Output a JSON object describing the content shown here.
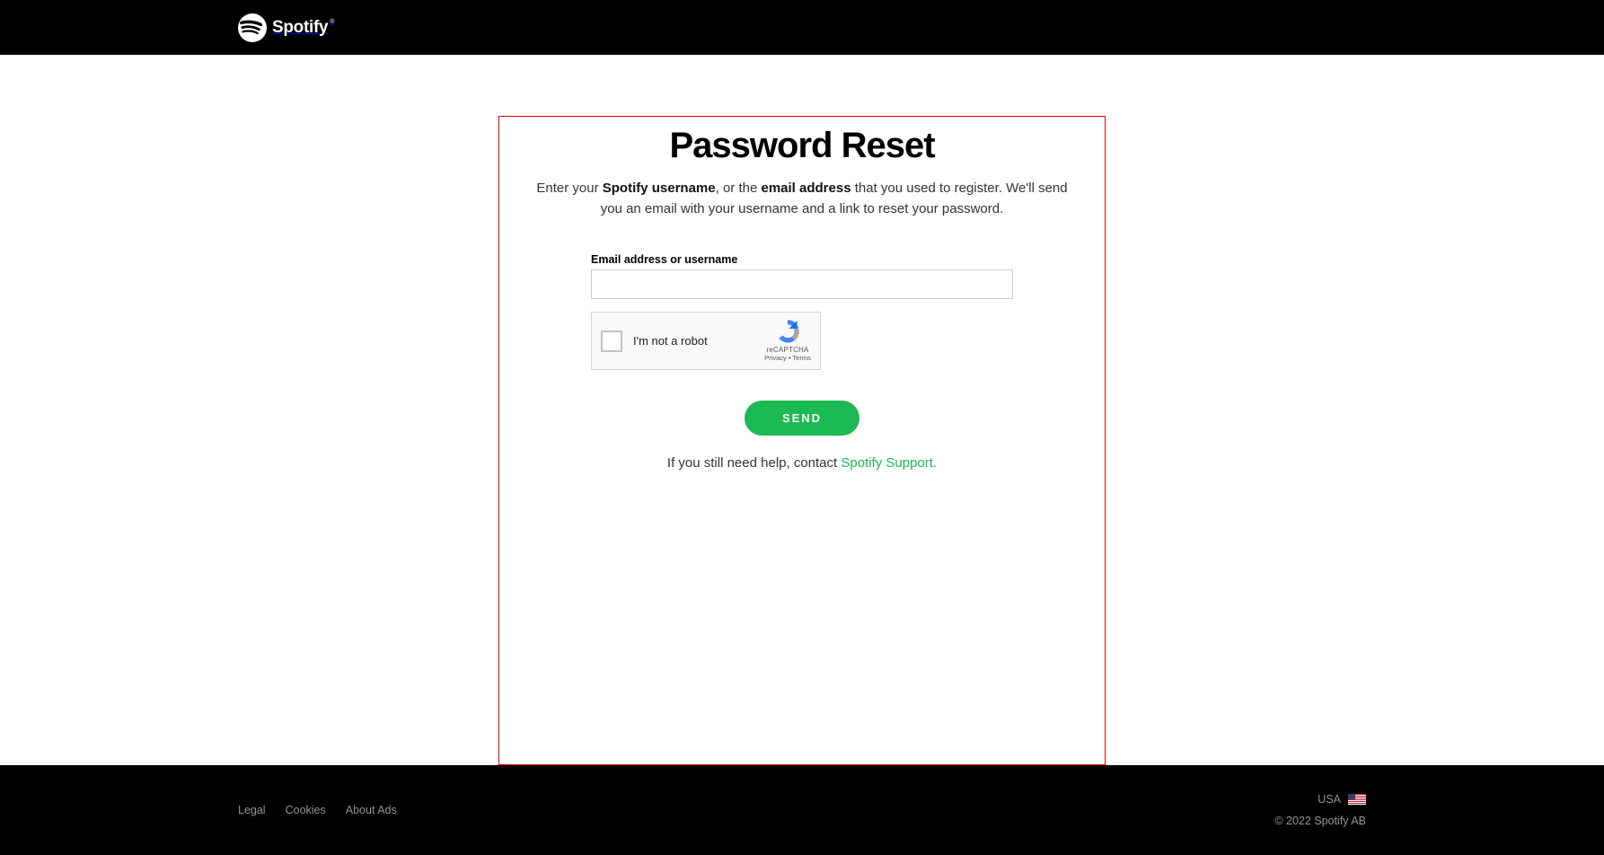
{
  "header": {
    "brand": "Spotify"
  },
  "main": {
    "title": "Password Reset",
    "instr_prefix": "Enter your ",
    "instr_bold1": "Spotify username",
    "instr_mid": ", or the ",
    "instr_bold2": "email address",
    "instr_suffix": " that you used to register. We'll send you an email with your username and a link to reset your password.",
    "field_label": "Email address or username",
    "input_value": "",
    "recaptcha_label": "I'm not a robot",
    "recaptcha_brand": "reCAPTCHA",
    "recaptcha_privacy": "Privacy",
    "recaptcha_sep": " • ",
    "recaptcha_terms": "Terms",
    "send_label": "SEND",
    "help_prefix": "If you still need help, contact ",
    "help_link": "Spotify Support."
  },
  "footer": {
    "links": [
      "Legal",
      "Cookies",
      "About Ads"
    ],
    "locale": "USA",
    "copyright": "© 2022 Spotify AB"
  }
}
